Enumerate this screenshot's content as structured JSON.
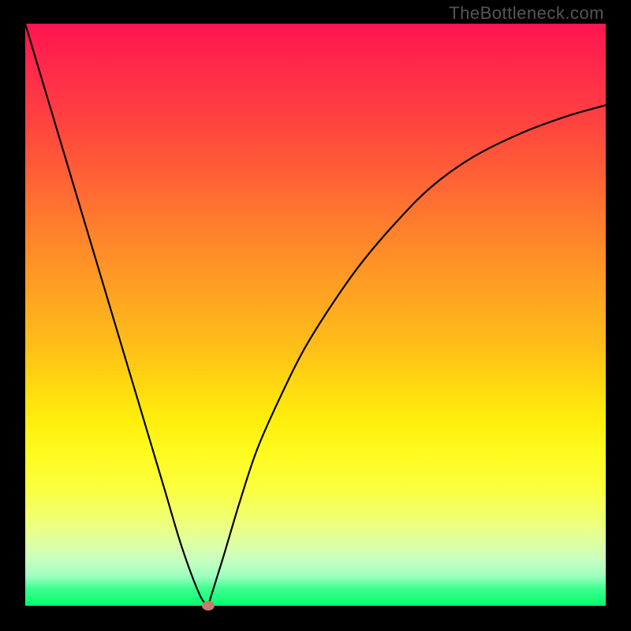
{
  "watermark": "TheBottleneck.com",
  "colors": {
    "frame": "#000000",
    "curve": "#000000",
    "dot": "#c77a6e"
  },
  "chart_data": {
    "type": "line",
    "title": "",
    "xlabel": "",
    "ylabel": "",
    "xlim": [
      0,
      100
    ],
    "ylim": [
      0,
      100
    ],
    "grid": false,
    "legend": false,
    "note": "V-shaped bottleneck curve on red-to-green gradient; vertex (optimal point) marked by dot.",
    "series": [
      {
        "name": "left-branch",
        "x": [
          0,
          3,
          6,
          9,
          12,
          15,
          18,
          21,
          24,
          27,
          30,
          31.5
        ],
        "values": [
          100,
          90,
          80,
          70,
          60,
          50,
          40,
          30,
          20,
          10,
          2,
          0
        ]
      },
      {
        "name": "right-branch",
        "x": [
          31.5,
          34,
          37,
          40,
          44,
          48,
          53,
          58,
          64,
          70,
          77,
          85,
          93,
          100
        ],
        "values": [
          0,
          8,
          18,
          27,
          36,
          44,
          52,
          59,
          66,
          72,
          77,
          81,
          84,
          86
        ]
      }
    ],
    "marker": {
      "x": 31.5,
      "y": 0
    }
  }
}
